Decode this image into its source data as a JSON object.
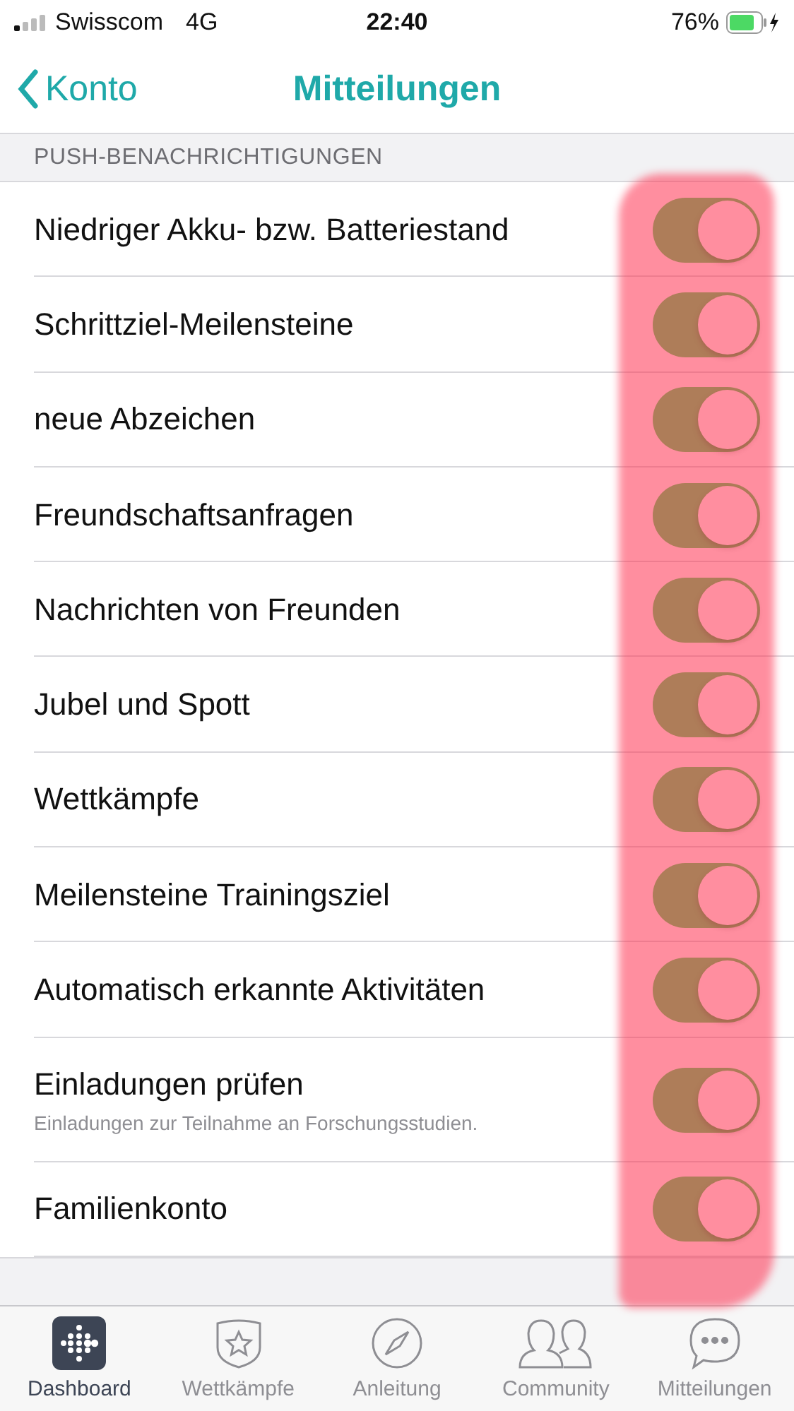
{
  "status_bar": {
    "carrier": "Swisscom",
    "network": "4G",
    "time": "22:40",
    "battery": "76%"
  },
  "nav": {
    "back": "Konto",
    "title": "Mitteilungen"
  },
  "section": {
    "header": "PUSH-BENACHRICHTIGUNGEN"
  },
  "settings": [
    {
      "label": "Niedriger Akku- bzw. Batteriestand",
      "on": true
    },
    {
      "label": "Schrittziel-Meilensteine",
      "on": true
    },
    {
      "label": "neue Abzeichen",
      "on": true
    },
    {
      "label": "Freundschaftsanfragen",
      "on": true
    },
    {
      "label": "Nachrichten von Freunden",
      "on": true
    },
    {
      "label": "Jubel und Spott",
      "on": true
    },
    {
      "label": "Wettkämpfe",
      "on": true
    },
    {
      "label": "Meilensteine Trainingsziel",
      "on": true
    },
    {
      "label": "Automatisch erkannte Aktivitäten",
      "on": true
    },
    {
      "label": "Einladungen prüfen",
      "subtitle": "Einladungen zur Teilnahme an Forschungsstudien.",
      "on": true
    },
    {
      "label": "Familienkonto",
      "on": true
    }
  ],
  "tab_bar": [
    {
      "label": "Dashboard",
      "kind": "dashboard",
      "selected": true
    },
    {
      "label": "Wettkämpfe",
      "kind": "challenges",
      "selected": false
    },
    {
      "label": "Anleitung",
      "kind": "guide",
      "selected": false
    },
    {
      "label": "Community",
      "kind": "community",
      "selected": false
    },
    {
      "label": "Mitteilungen",
      "kind": "messages",
      "selected": false
    }
  ]
}
